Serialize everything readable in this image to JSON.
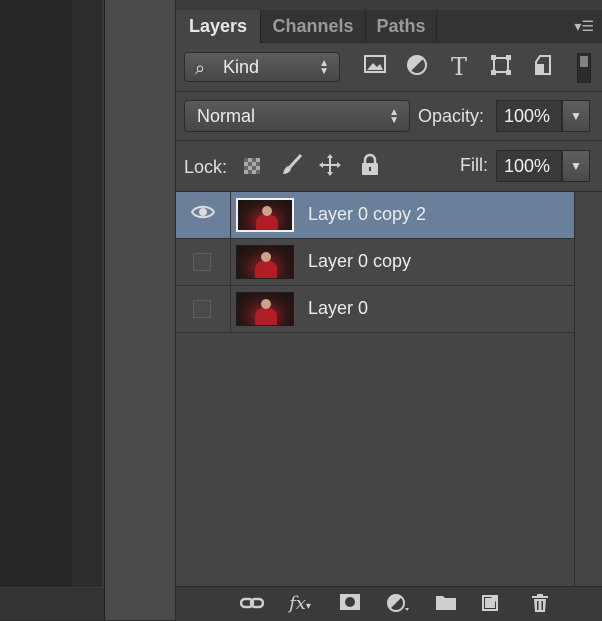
{
  "tabs": [
    "Layers",
    "Channels",
    "Paths"
  ],
  "panel_menu_icon": "panel-menu-icon",
  "filter": {
    "kind_icon": "⌕",
    "kind_label": "Kind",
    "icons": [
      "image-filter-icon",
      "adjustment-filter-icon",
      "type-filter-icon",
      "shape-filter-icon",
      "smart-object-filter-icon"
    ]
  },
  "blend": {
    "mode": "Normal",
    "opacity_label": "Opacity:",
    "opacity_value": "100%"
  },
  "lock": {
    "label": "Lock:",
    "fill_label": "Fill:",
    "fill_value": "100%",
    "icons": [
      "lock-transparent-pixels-icon",
      "lock-image-pixels-icon",
      "lock-position-icon",
      "lock-all-icon"
    ]
  },
  "layers": [
    {
      "name": "Layer 0 copy 2",
      "visible": true,
      "selected": true
    },
    {
      "name": "Layer 0 copy",
      "visible": false,
      "selected": false
    },
    {
      "name": "Layer 0",
      "visible": false,
      "selected": false
    }
  ],
  "bottom_icons": [
    "link-layers-icon",
    "fx-icon",
    "add-mask-icon",
    "new-adjustment-layer-icon",
    "new-group-icon",
    "new-layer-icon",
    "delete-layer-icon"
  ],
  "fx_label": "fx"
}
